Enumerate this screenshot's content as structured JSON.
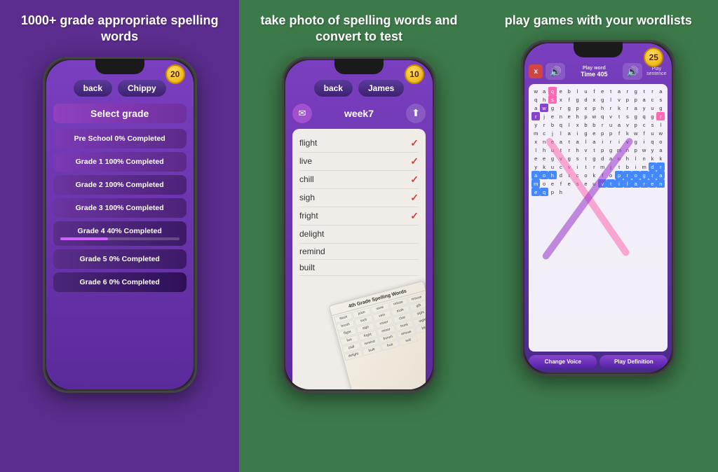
{
  "panel1": {
    "title": "1000+ grade appropriate\nspelling words",
    "badge": "20",
    "nav_back": "back",
    "nav_name": "Chippy",
    "header": "Select grade",
    "grades": [
      {
        "label": "Pre School 0% Completed",
        "progress": 0,
        "class": "grade-0"
      },
      {
        "label": "Grade 1 100% Completed",
        "progress": 100,
        "class": "grade-1"
      },
      {
        "label": "Grade 2 100% Completed",
        "progress": 100,
        "class": "grade-2"
      },
      {
        "label": "Grade 3 100% Completed",
        "progress": 100,
        "class": "grade-3"
      },
      {
        "label": "Grade 4 40% Completed",
        "progress": 40,
        "class": "grade-4"
      },
      {
        "label": "Grade 5 0% Completed",
        "progress": 0,
        "class": "grade-5"
      },
      {
        "label": "Grade 6 0% Completed",
        "progress": 0,
        "class": "grade-6"
      }
    ]
  },
  "panel2": {
    "title": "take photo of spelling\nwords and convert to test",
    "badge": "10",
    "nav_back": "back",
    "nav_name": "James",
    "week_label": "week7",
    "words": [
      {
        "word": "flight",
        "checked": true
      },
      {
        "word": "live",
        "checked": true
      },
      {
        "word": "chill",
        "checked": true
      },
      {
        "word": "sigh",
        "checked": true
      },
      {
        "word": "fright",
        "checked": true
      },
      {
        "word": "delight",
        "checked": false
      },
      {
        "word": "remind",
        "checked": false
      },
      {
        "word": "built",
        "checked": false
      }
    ],
    "paper_title": "4th Grade Spelling Words",
    "paper_words": [
      "stuck",
      "juice",
      "vane",
      "refuse",
      "rescue",
      "brush",
      "inch",
      "vein",
      "truth",
      "gift",
      "flight",
      "sigh",
      "miner",
      "clue",
      "sight",
      "live",
      "fright",
      "minor",
      "trunk",
      "sight",
      "chill",
      "remind",
      "bunch",
      "amuse",
      "blin",
      "delight",
      "built",
      "fruit",
      "suit"
    ]
  },
  "panel3": {
    "title": "play games with\nyour wordlists",
    "badge": "25",
    "x_btn": "x",
    "timer_label": "Time 405",
    "play_word_label": "Play word",
    "play_sentence_label": "Play sentence",
    "bottom_btn1": "Change Voice",
    "bottom_btn2": "Play Definition",
    "grid_rows": [
      "waqeblufetargtr",
      "aqhsxfgdxglvp",
      "pacsaw grgpxphr",
      "krayu grlenehhpw",
      "qvtsgqgryrb qlx",
      "bbrua vpcslmc",
      "jlaig epfkwfuw",
      "xnea talairiv giq",
      "olhut rhvtpgmnp",
      "wyae egvgstgd au",
      "hlnkkykucvit rm",
      "jtbim draohdrco",
      "kfop rogramoefes",
      "euvtlilareneqph"
    ]
  }
}
